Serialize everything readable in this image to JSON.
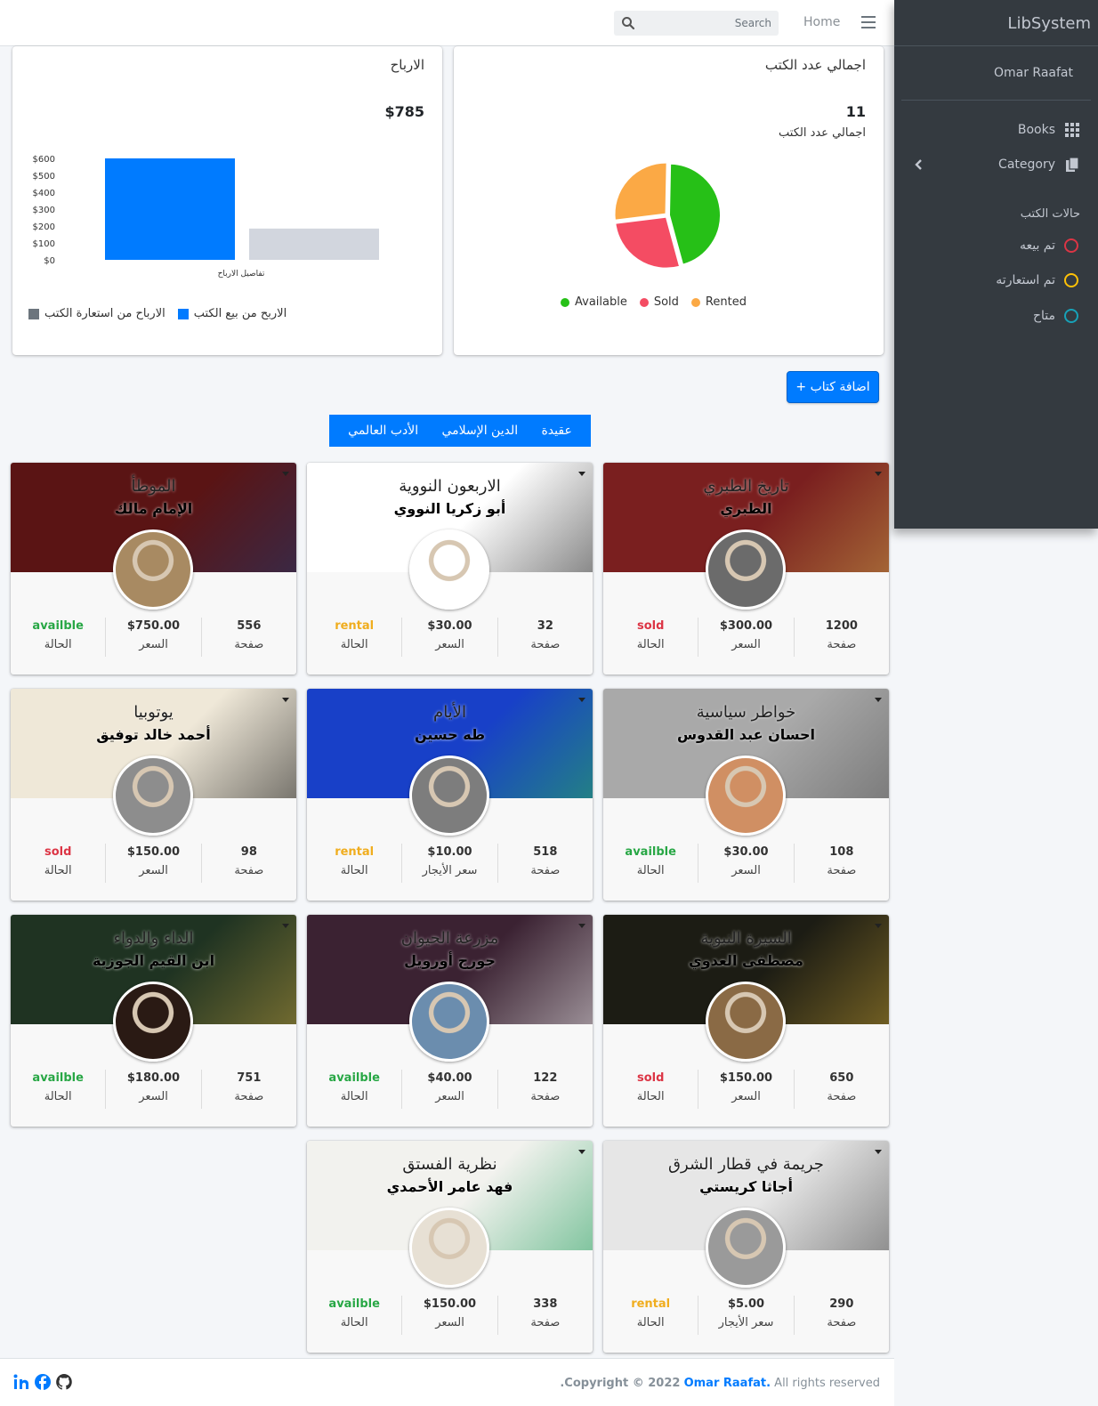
{
  "navbar": {
    "search_placeholder": "Search",
    "home_label": "Home"
  },
  "sidebar": {
    "brand": "LibSystem",
    "user": "Omar Raafat",
    "items": [
      {
        "label": "Books",
        "icon": "grid-icon"
      },
      {
        "label": "Category",
        "icon": "copy-icon"
      }
    ],
    "status_header": "حالات الكتب",
    "statuses": [
      {
        "label": "تم بيعه",
        "color": "#dc3545"
      },
      {
        "label": "تم استعارته",
        "color": "#ffc107"
      },
      {
        "label": "متاح",
        "color": "#17a2b8"
      }
    ]
  },
  "books_card": {
    "title": "اجمالي عدد الكتب",
    "total": "11",
    "sublabel": "اجمالي عدد الكتب",
    "chart_data": {
      "type": "pie",
      "categories": [
        "Available",
        "Sold",
        "Rented"
      ],
      "values": [
        5,
        3,
        3
      ],
      "colors": [
        "#26c017",
        "#f44c63",
        "#fba945"
      ]
    },
    "legend": [
      "Available",
      "Sold",
      "Rented"
    ]
  },
  "profit_card": {
    "title": "الارباح",
    "total": "$785",
    "chart_data": {
      "type": "bar",
      "categories": [
        "تفاصيل الارباح"
      ],
      "series": [
        {
          "name": "الاربح من بيع الكتب",
          "values": [
            600
          ],
          "color": "#007bff"
        },
        {
          "name": "الارباح من استعارة الكتب",
          "values": [
            185
          ],
          "color": "#d2d6de"
        }
      ],
      "yticks": [
        "$600",
        "$500",
        "$400",
        "$300",
        "$200",
        "$100",
        "$0"
      ],
      "ylim": [
        0,
        600
      ],
      "xlabel": "تفاصيل الارباح"
    },
    "legend": [
      {
        "label": "الاربح من بيع الكتب",
        "color": "#007bff"
      },
      {
        "label": "الارباح من استعارة الكتب",
        "color": "#6c757d"
      }
    ]
  },
  "add_button": "+ اضافة كتاب",
  "tabs": [
    "عقيدة",
    "الدين الإسلامي",
    "الأدب العالمي"
  ],
  "books": [
    {
      "title": "تاريخ الطبري",
      "author": "الطبري",
      "pages": "1200",
      "price": "$300.00",
      "price_label": "السعر",
      "status": "sold",
      "cover": "#7a1f1f",
      "accent": "#c8a24a",
      "avatar": "#6b6b6b"
    },
    {
      "title": "الاربعون النووية",
      "author": "أبو زكريا النووي",
      "pages": "32",
      "price": "$30.00",
      "price_label": "السعر",
      "status": "rental",
      "cover": "#ffffff",
      "accent": "#222222",
      "avatar": "#ffffff"
    },
    {
      "title": "الموطأ",
      "author": "الإمام مالك",
      "pages": "556",
      "price": "$750.00",
      "price_label": "السعر",
      "status": "availble",
      "cover": "#5a1414",
      "accent": "#1f3a6e",
      "avatar": "#a88a62"
    },
    {
      "title": "خواطر سياسية",
      "author": "احسان عبد القدوس",
      "pages": "108",
      "price": "$30.00",
      "price_label": "السعر",
      "status": "availble",
      "cover": "#a9a9a9",
      "accent": "#555555",
      "avatar": "#d08f63"
    },
    {
      "title": "الأيام",
      "author": "طه حسين",
      "pages": "518",
      "price": "$10.00",
      "price_label": "سعر الأيجار",
      "status": "rental",
      "cover": "#1840c8",
      "accent": "#2db84b",
      "avatar": "#7d7d7d"
    },
    {
      "title": "يوتوبيا",
      "author": "أحمد خالد توفيق",
      "pages": "98",
      "price": "$150.00",
      "price_label": "السعر",
      "status": "sold",
      "cover": "#efe8d8",
      "accent": "#111111",
      "avatar": "#8d8d8d"
    },
    {
      "title": "السيرة النبوية",
      "author": "مصطفى العدوي",
      "pages": "650",
      "price": "$150.00",
      "price_label": "السعر",
      "status": "sold",
      "cover": "#1c1c14",
      "accent": "#b8962f",
      "avatar": "#8a6a45"
    },
    {
      "title": "مزرعة الحيوان",
      "author": "جورج أورويل",
      "pages": "122",
      "price": "$40.00",
      "price_label": "السعر",
      "status": "availble",
      "cover": "#3b2232",
      "accent": "#eeeeee",
      "avatar": "#6b8dae"
    },
    {
      "title": "الداء والدواء",
      "author": "ابن القيم الجوزية",
      "pages": "751",
      "price": "$180.00",
      "price_label": "السعر",
      "status": "availble",
      "cover": "#1f3322",
      "accent": "#b89a3c",
      "avatar": "#2a1a14"
    },
    {
      "title": "جريمة في قطار الشرق",
      "author": "أجاثا كريستي",
      "pages": "290",
      "price": "$5.00",
      "price_label": "سعر الأيجار",
      "status": "rental",
      "cover": "#e6e6e6",
      "accent": "#444444",
      "avatar": "#9a9a9a"
    },
    {
      "title": "نظرية الفستق",
      "author": "فهد عامر الأحمدي",
      "pages": "338",
      "price": "$150.00",
      "price_label": "السعر",
      "status": "availble",
      "cover": "#f2f2ee",
      "accent": "#1e9d5a",
      "avatar": "#e7e0d4"
    }
  ],
  "stat_labels": {
    "pages": "صفحة",
    "status": "الحالة"
  },
  "footer": {
    "prefix": ".Copyright © 2022",
    "owner": "Omar Raafat.",
    "suffix": "All rights reserved"
  }
}
